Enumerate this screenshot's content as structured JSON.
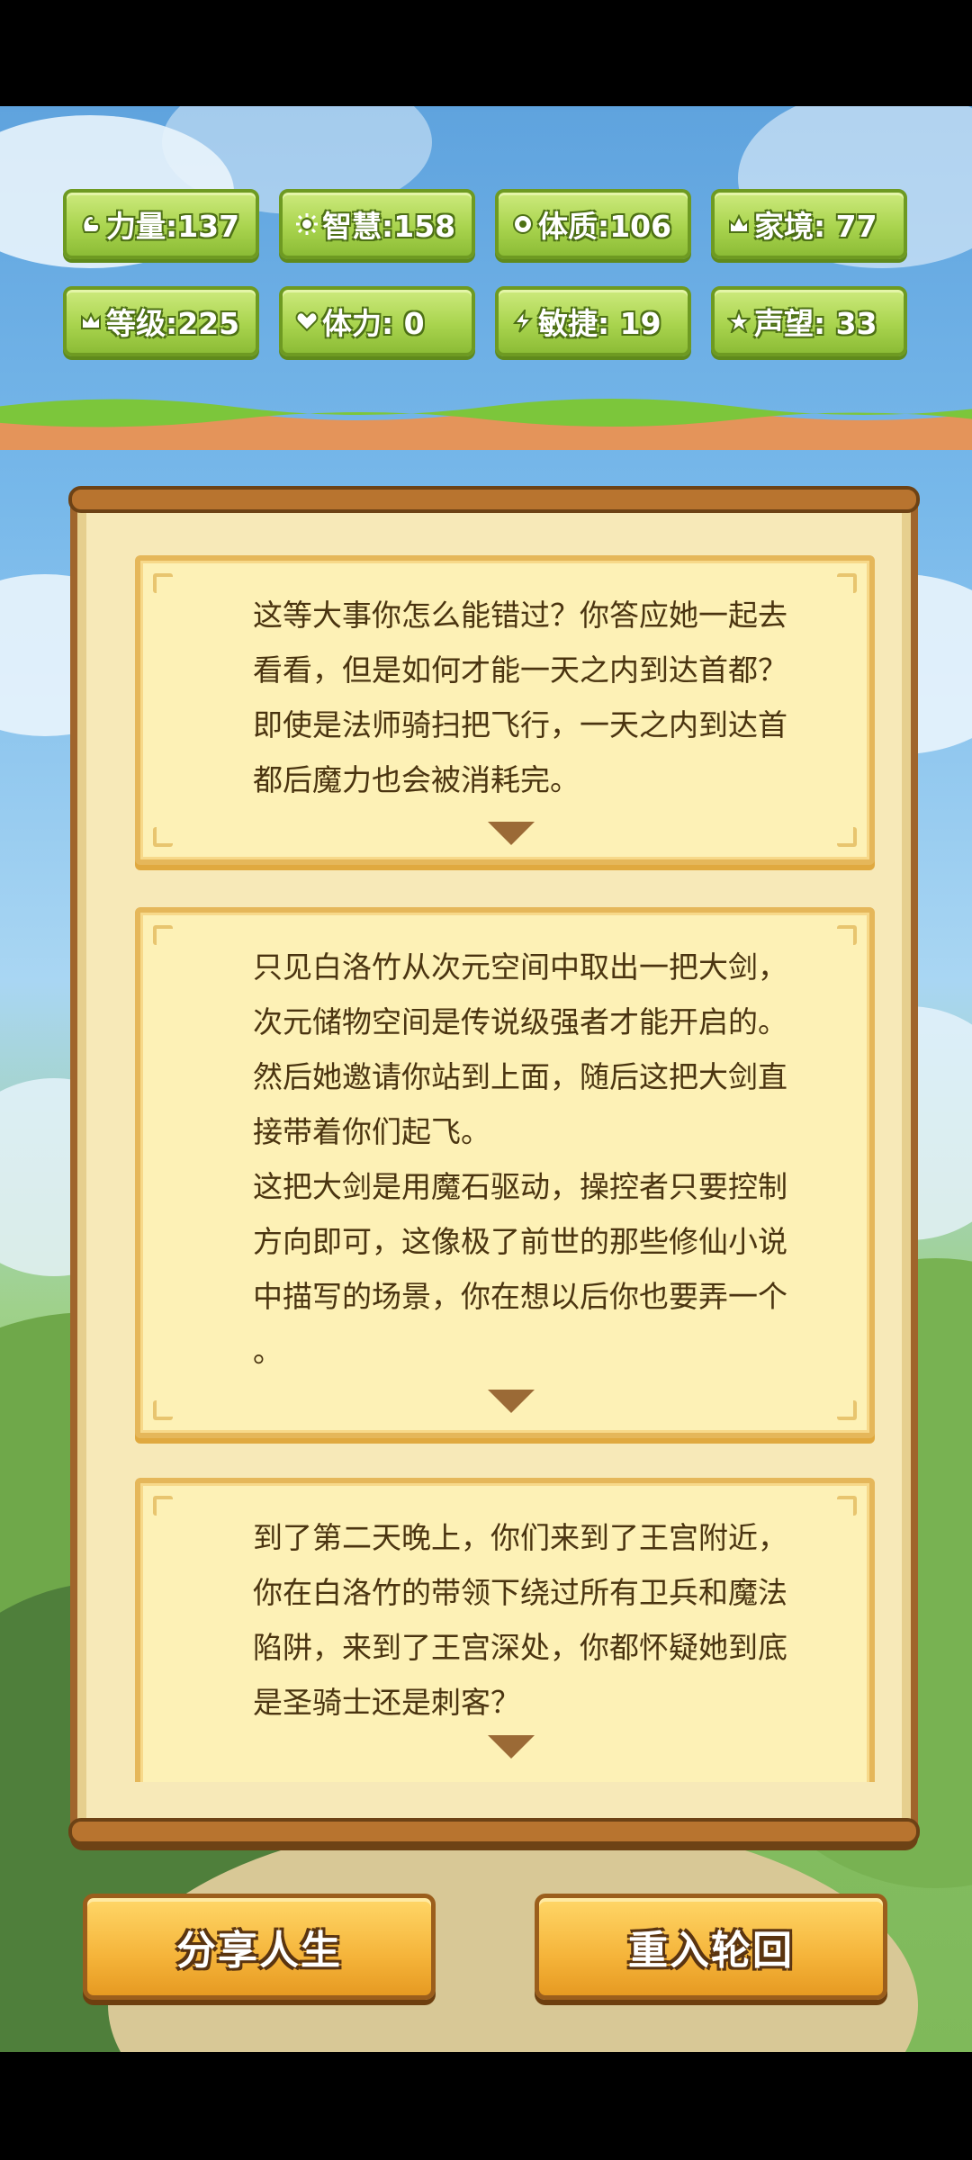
{
  "stats": [
    {
      "icon": "strength-icon",
      "text": "力量:137"
    },
    {
      "icon": "wisdom-icon",
      "text": "智慧:158"
    },
    {
      "icon": "constitution-icon",
      "text": "体质:106"
    },
    {
      "icon": "family-icon",
      "text": "家境: 77"
    },
    {
      "icon": "crown-icon",
      "text": "等级:225"
    },
    {
      "icon": "heart-icon",
      "text": "体力: 0"
    },
    {
      "icon": "lightning-icon",
      "text": "敏捷: 19"
    },
    {
      "icon": "star-icon",
      "text": "声望: 33"
    }
  ],
  "events": [
    {
      "text": "这等大事你怎么能错过？你答应她一起去\n看看，但是如何才能一天之内到达首都？\n即使是法师骑扫把飞行，一天之内到达首\n都后魔力也会被消耗完。"
    },
    {
      "text": "只见白洛竹从次元空间中取出一把大剑，\n次元储物空间是传说级强者才能开启的。\n然后她邀请你站到上面，随后这把大剑直\n接带着你们起飞。\n这把大剑是用魔石驱动，操控者只要控制\n方向即可，这像极了前世的那些修仙小说\n中描写的场景，你在想以后你也要弄一个\n。"
    },
    {
      "text": "到了第二天晚上，你们来到了王宫附近，\n你在白洛竹的带领下绕过所有卫兵和魔法\n陷阱，来到了王宫深处，你都怀疑她到底\n是圣骑士还是刺客？"
    }
  ],
  "buttons": {
    "share_label": "分享人生",
    "restart_label": "重入轮回"
  },
  "colors": {
    "stat_green": "#a9d44e",
    "card_bg": "#fdf1b6",
    "button_orange": "#f5b43a"
  }
}
